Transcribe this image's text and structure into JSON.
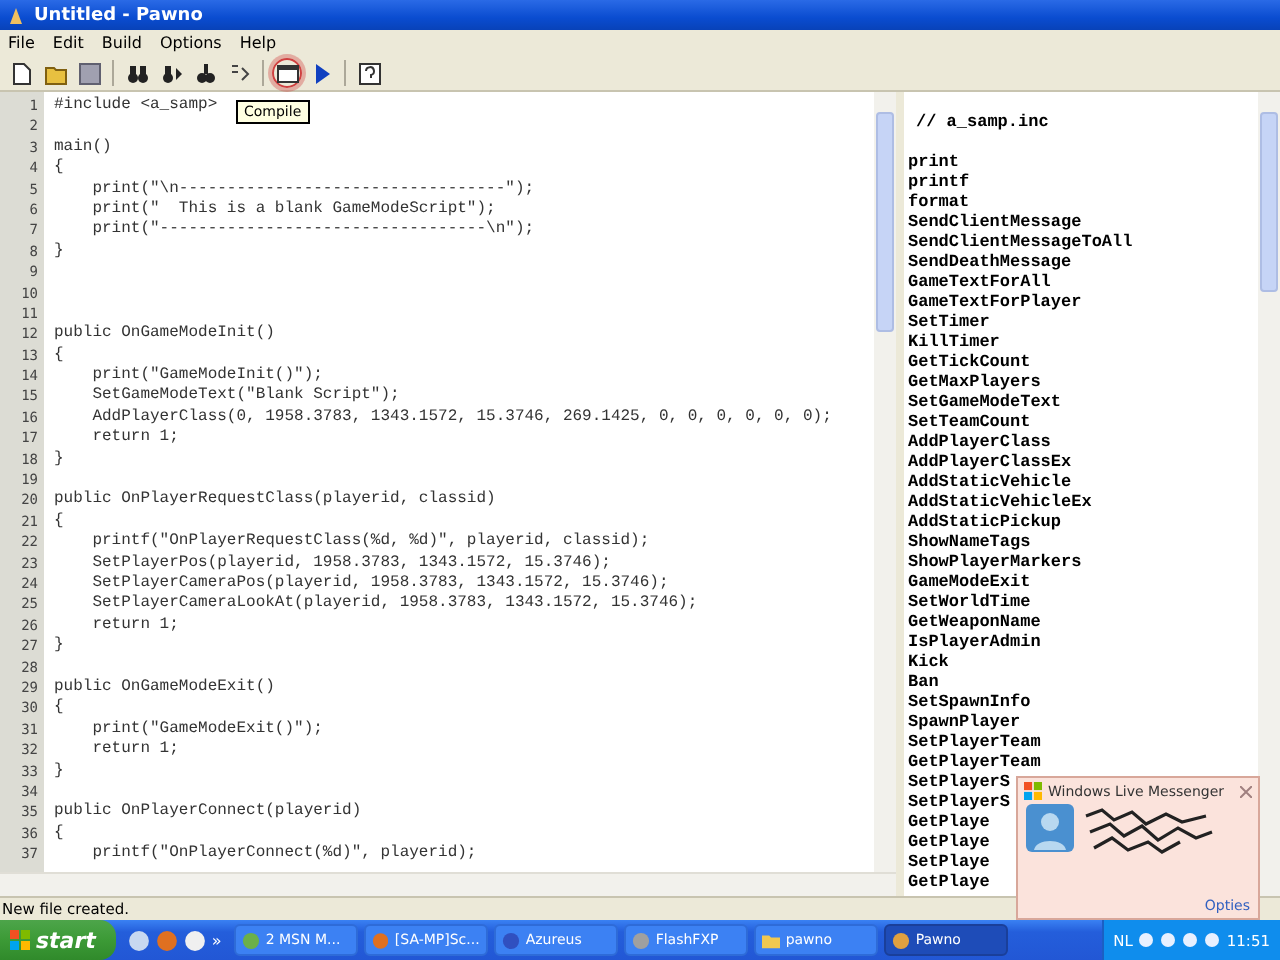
{
  "window": {
    "title": "Untitled - Pawno"
  },
  "menu": [
    "File",
    "Edit",
    "Build",
    "Options",
    "Help"
  ],
  "toolbar": [
    {
      "kind": "new",
      "circled": false
    },
    {
      "kind": "open",
      "circled": false
    },
    {
      "kind": "save",
      "circled": false
    },
    {
      "kind": "sep"
    },
    {
      "kind": "find",
      "circled": false
    },
    {
      "kind": "findnext",
      "circled": false
    },
    {
      "kind": "replace",
      "circled": false
    },
    {
      "kind": "goto",
      "circled": false
    },
    {
      "kind": "sep"
    },
    {
      "kind": "compile",
      "circled": true
    },
    {
      "kind": "run",
      "circled": false
    },
    {
      "kind": "sep"
    },
    {
      "kind": "help",
      "circled": false
    }
  ],
  "tooltip": "Compile",
  "editor": {
    "lines": [
      {
        "number": "1",
        "text": "#include <a_samp>"
      },
      {
        "number": "2"
      },
      {
        "number": "3",
        "text": "main()"
      },
      {
        "number": "4",
        "text": "{"
      },
      {
        "number": "5",
        "text": "    print(\"\\n----------------------------------\");"
      },
      {
        "number": "6",
        "text": "    print(\"  This is a blank GameModeScript\");"
      },
      {
        "number": "7",
        "text": "    print(\"----------------------------------\\n\");"
      },
      {
        "number": "8",
        "text": "}"
      },
      {
        "number": "9"
      },
      {
        "number": "10"
      },
      {
        "number": "11"
      },
      {
        "number": "12",
        "text": "public OnGameModeInit()"
      },
      {
        "number": "13",
        "text": "{"
      },
      {
        "number": "14",
        "text": "    print(\"GameModeInit()\");"
      },
      {
        "number": "15",
        "text": "    SetGameModeText(\"Blank Script\");"
      },
      {
        "number": "16",
        "text": "    AddPlayerClass(0, 1958.3783, 1343.1572, 15.3746, 269.1425, 0, 0, 0, 0, 0, 0);"
      },
      {
        "number": "17",
        "text": "    return 1;"
      },
      {
        "number": "18",
        "text": "}"
      },
      {
        "number": "19"
      },
      {
        "number": "20",
        "text": "public OnPlayerRequestClass(playerid, classid)"
      },
      {
        "number": "21",
        "text": "{"
      },
      {
        "number": "22",
        "text": "    printf(\"OnPlayerRequestClass(%d, %d)\", playerid, classid);"
      },
      {
        "number": "23",
        "text": "    SetPlayerPos(playerid, 1958.3783, 1343.1572, 15.3746);"
      },
      {
        "number": "24",
        "text": "    SetPlayerCameraPos(playerid, 1958.3783, 1343.1572, 15.3746);"
      },
      {
        "number": "25",
        "text": "    SetPlayerCameraLookAt(playerid, 1958.3783, 1343.1572, 15.3746);"
      },
      {
        "number": "26",
        "text": "    return 1;"
      },
      {
        "number": "27",
        "text": "}"
      },
      {
        "number": "28"
      },
      {
        "number": "29",
        "text": "public OnGameModeExit()"
      },
      {
        "number": "30",
        "text": "{"
      },
      {
        "number": "31",
        "text": "    print(\"GameModeExit()\");"
      },
      {
        "number": "32",
        "text": "    return 1;"
      },
      {
        "number": "33",
        "text": "}"
      },
      {
        "number": "34"
      },
      {
        "number": "35",
        "text": "public OnPlayerConnect(playerid)"
      },
      {
        "number": "36",
        "text": "{"
      },
      {
        "number": "37",
        "text": "    printf(\"OnPlayerConnect(%d)\", playerid);"
      }
    ]
  },
  "functions": {
    "header": "// a_samp.inc",
    "items": [
      "print",
      "printf",
      "format",
      "SendClientMessage",
      "SendClientMessageToAll",
      "SendDeathMessage",
      "GameTextForAll",
      "GameTextForPlayer",
      "SetTimer",
      "KillTimer",
      "GetTickCount",
      "GetMaxPlayers",
      "SetGameModeText",
      "SetTeamCount",
      "AddPlayerClass",
      "AddPlayerClassEx",
      "AddStaticVehicle",
      "AddStaticVehicleEx",
      "AddStaticPickup",
      "ShowNameTags",
      "ShowPlayerMarkers",
      "GameModeExit",
      "SetWorldTime",
      "GetWeaponName",
      "IsPlayerAdmin",
      "Kick",
      "Ban",
      "SetSpawnInfo",
      "SpawnPlayer",
      "SetPlayerTeam",
      "GetPlayerTeam",
      "SetPlayerS",
      "SetPlayerS",
      "GetPlaye",
      "GetPlaye",
      "SetPlaye",
      "GetPlaye"
    ]
  },
  "status_bar": "New file created.",
  "notification": {
    "title": "Windows Live Messenger",
    "link": "Opties"
  },
  "taskbar": {
    "start": "start",
    "quick_launch": [
      {
        "kind": "ie"
      },
      {
        "kind": "firefox"
      },
      {
        "kind": "media"
      }
    ],
    "more": "»",
    "tasks": [
      {
        "label": "2 MSN M...",
        "kind": "msn",
        "selected": false
      },
      {
        "label": "[SA-MP]Sc...",
        "kind": "firefox",
        "selected": false
      },
      {
        "label": "Azureus",
        "kind": "azureus",
        "selected": false
      },
      {
        "label": "FlashFXP",
        "kind": "ftp",
        "selected": false
      },
      {
        "label": "pawno",
        "kind": "folder",
        "selected": false
      },
      {
        "label": "Pawno",
        "kind": "pawno",
        "selected": true
      }
    ],
    "language": "NL",
    "clock": "11:51"
  }
}
